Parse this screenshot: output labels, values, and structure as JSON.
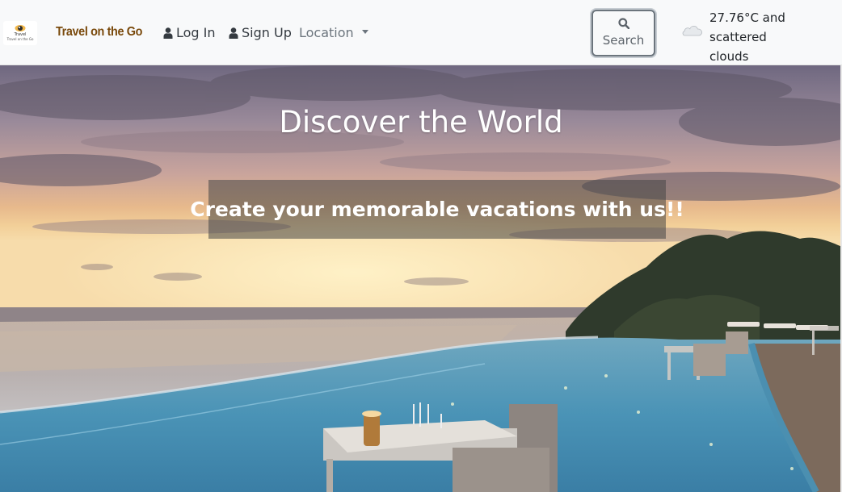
{
  "navbar": {
    "logo": {
      "line1": "Travel",
      "line2": "Travel on the Go"
    },
    "brand": "Travel on the Go",
    "login_label": "Log In",
    "signup_label": "Sign Up",
    "location_label": "Location",
    "search_label": "Search",
    "weather_line1": "27.76°C and scattered",
    "weather_line2": "clouds",
    "icons": {
      "login": "user-icon",
      "signup": "user-icon",
      "location": "caret-down-icon",
      "search": "search-icon",
      "weather": "cloud-icon"
    },
    "colors": {
      "brand": "#7a4a0c",
      "navbar_bg": "#f8f9fa",
      "link": "#343a40"
    }
  },
  "hero": {
    "title": "Discover the World",
    "subtitle": "Create your memorable vacations with us!!"
  }
}
